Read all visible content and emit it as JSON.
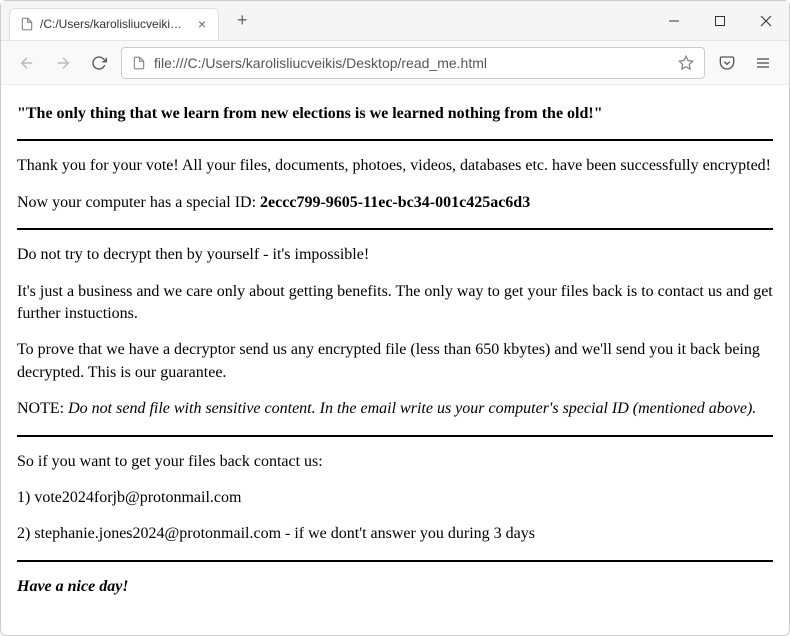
{
  "tab": {
    "title": "/C:/Users/karolisliucveikis/Desktop/",
    "close_label": "×"
  },
  "new_tab_label": "+",
  "toolbar": {
    "url": "file:///C:/Users/karolisliucveikis/Desktop/read_me.html"
  },
  "content": {
    "heading": "\"The only thing that we learn from new elections is we learned nothing from the old!\"",
    "p1": "Thank you for your vote! All your files, documents, photoes, videos, databases etc. have been successfully encrypted!",
    "p2_prefix": "Now your computer has a special ID: ",
    "p2_id": "2eccc799-9605-11ec-bc34-001c425ac6d3",
    "p3": "Do not try to decrypt then by yourself - it's impossible!",
    "p4": "It's just a business and we care only about getting benefits. The only way to get your files back is to contact us and get further instuctions.",
    "p5": "To prove that we have a decryptor send us any encrypted file (less than 650 kbytes) and we'll send you it back being decrypted. This is our guarantee.",
    "p6_prefix": "NOTE: ",
    "p6_note": "Do not send file with sensitive content. In the email write us your computer's special ID (mentioned above).",
    "p7": "So if you want to get your files back contact us:",
    "p8": "1) vote2024forjb@protonmail.com",
    "p9": "2) stephanie.jones2024@protonmail.com - if we dont't answer you during 3 days",
    "p10": "Have a nice day!"
  }
}
